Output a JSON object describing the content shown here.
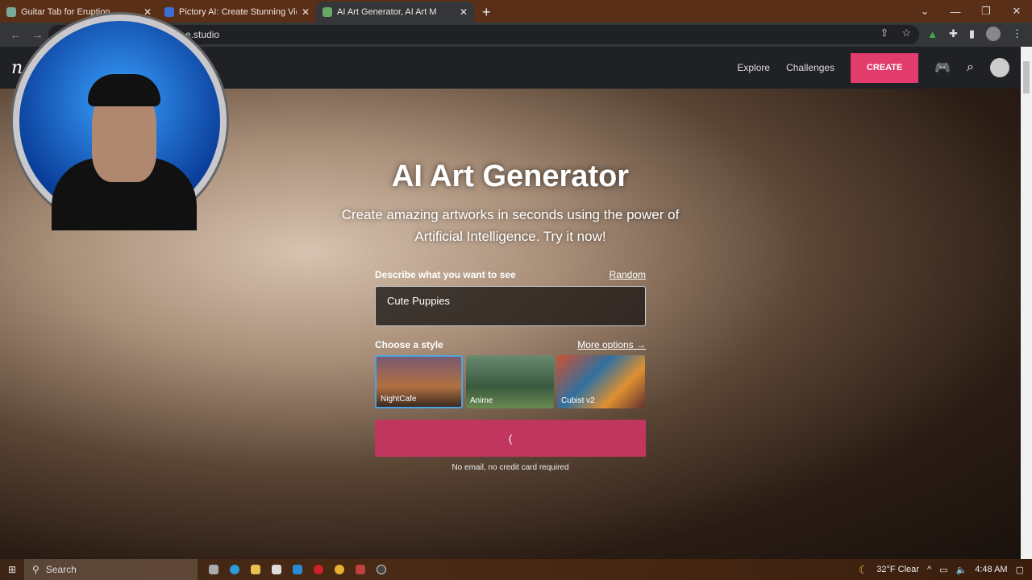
{
  "browser": {
    "tabs": [
      {
        "title": "Guitar Tab for Eruption.",
        "active": false
      },
      {
        "title": "Pictory AI: Create Stunning Video",
        "active": false
      },
      {
        "title": "AI Art Generator, AI Art M",
        "active": true
      }
    ],
    "url": "e.studio"
  },
  "site": {
    "logo": "n",
    "nav": [
      {
        "label": "Explore"
      },
      {
        "label": "Challenges"
      }
    ],
    "create_label": "CREATE",
    "accent": "#e13c6c",
    "hero": {
      "title": "AI Art Generator",
      "subtitle": "Create amazing artworks in seconds using the power of Artificial Intelligence. Try it now!"
    },
    "form": {
      "prompt_label": "Describe what you want to see",
      "random_label": "Random",
      "prompt_value": "Cute Puppies",
      "style_label": "Choose a style",
      "more_options_label": "More options →",
      "styles": [
        {
          "name": "NightCafe",
          "selected": true
        },
        {
          "name": "Anime",
          "selected": false
        },
        {
          "name": "Cubist v2",
          "selected": false
        }
      ],
      "submit_label": "(",
      "note": "No email, no credit card required"
    }
  },
  "taskbar": {
    "search_placeholder": "Search",
    "weather": "32°F Clear",
    "time": "4:48 AM"
  }
}
